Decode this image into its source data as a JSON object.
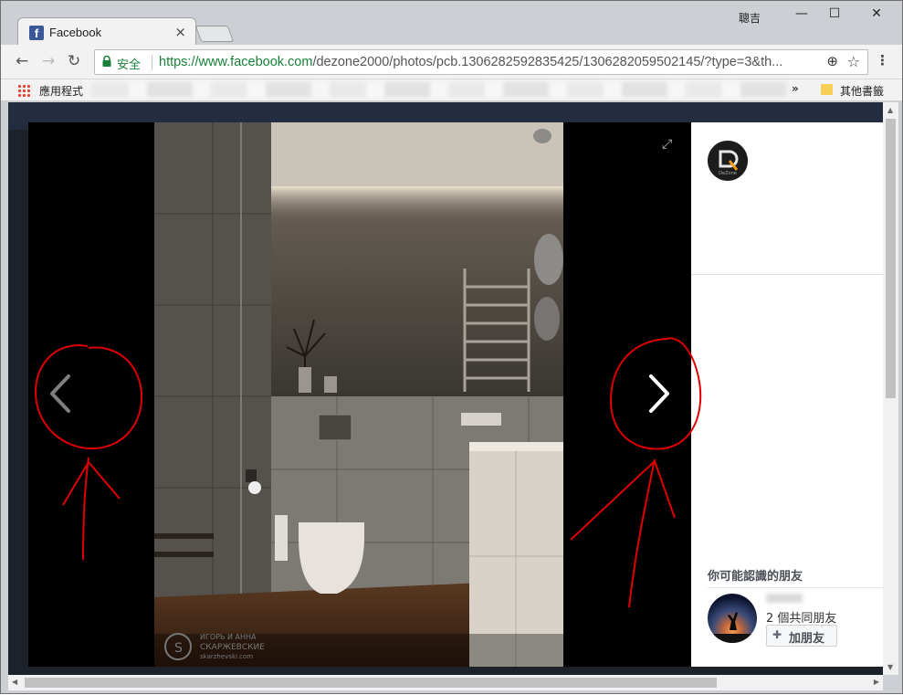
{
  "window": {
    "user_name": "聰吉",
    "minimize_label": "—",
    "maximize_label": "☐",
    "close_label": "✕"
  },
  "tabs": [
    {
      "favicon": "f",
      "title": "Facebook",
      "close_label": "×"
    }
  ],
  "toolbar": {
    "back_icon": "←",
    "forward_icon": "→",
    "reload_icon": "↻",
    "security_label": "安全",
    "url_scheme_host": "https://www.facebook.com",
    "url_rest": "/dezone2000/photos/pcb.1306282592835425/1306282059502145/?type=3&th...",
    "zoom_icon": "⊕",
    "star_icon": "☆",
    "menu_icon": "⋮"
  },
  "bookmarks": {
    "apps_label": "應用程式",
    "overflow_icon": "»",
    "other_label": "其他書籤"
  },
  "viewer": {
    "expand_icon": "⤢",
    "prev_icon": "chevron-left-icon",
    "next_icon": "chevron-right-icon"
  },
  "sidebar": {
    "page_avatar_text": "DeZone",
    "pymk_title": "你可能認識的朋友",
    "mutual_friends": "2 個共同朋友",
    "add_friend_label": "加朋友"
  },
  "watermark": {
    "line1": "ИГОРЬ И АННА",
    "line2": "СКАРЖЕВСКИЕ",
    "line3": "skarzhevski.com"
  },
  "colors": {
    "secure_green": "#188038",
    "facebook_blue": "#3b5998",
    "annotation_red": "#e00000"
  }
}
